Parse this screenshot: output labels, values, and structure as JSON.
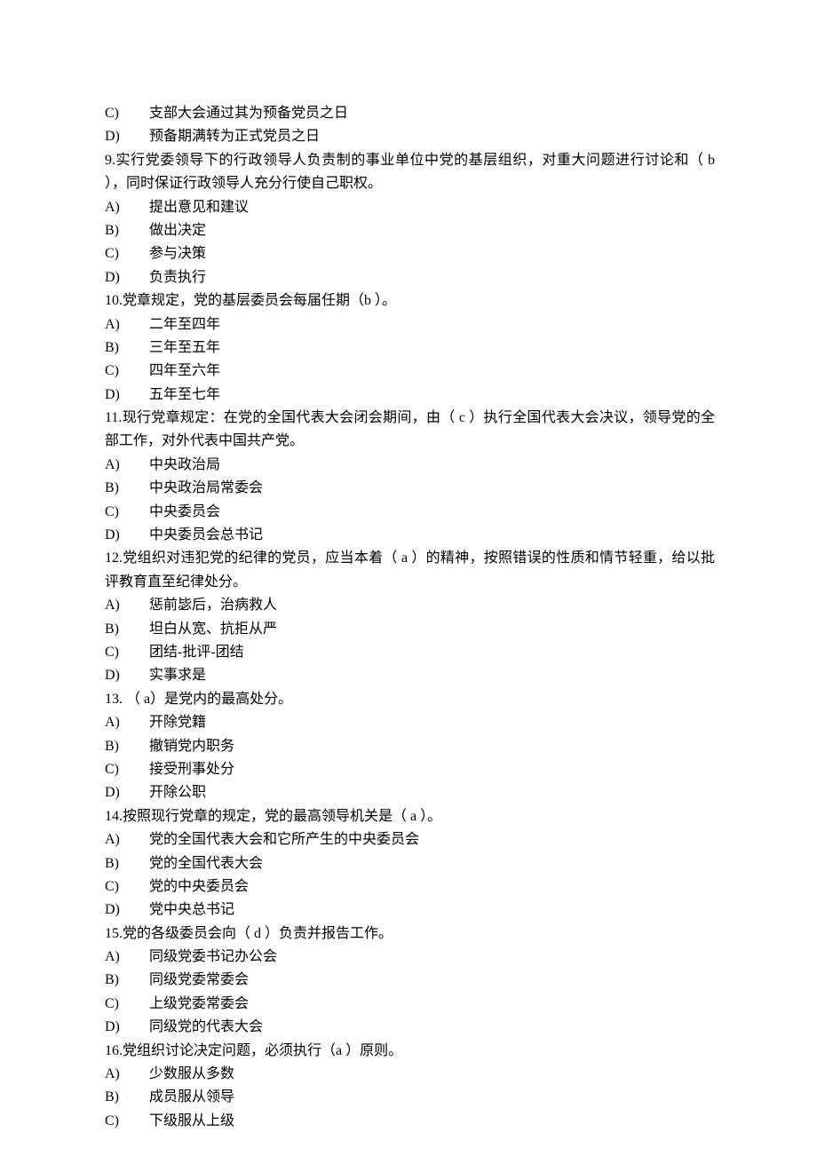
{
  "lines": [
    {
      "type": "opt",
      "letter": "C)",
      "text": "支部大会通过其为预备党员之日"
    },
    {
      "type": "opt",
      "letter": "D)",
      "text": "预备期满转为正式党员之日"
    },
    {
      "type": "q",
      "text": "9.实行党委领导下的行政领导人负责制的事业单位中党的基层组织，对重大问题进行讨论和（ b  ），同时保证行政领导人充分行使自己职权。"
    },
    {
      "type": "opt",
      "letter": "A)",
      "text": "提出意见和建议"
    },
    {
      "type": "opt",
      "letter": "B)",
      "text": "做出决定"
    },
    {
      "type": "opt",
      "letter": "C)",
      "text": "参与决策"
    },
    {
      "type": "opt",
      "letter": "D)",
      "text": "负责执行"
    },
    {
      "type": "q",
      "text": "10.党章规定，党的基层委员会每届任期（b   ）。"
    },
    {
      "type": "opt",
      "letter": "A)",
      "text": "二年至四年"
    },
    {
      "type": "opt",
      "letter": "B)",
      "text": "三年至五年"
    },
    {
      "type": "opt",
      "letter": "C)",
      "text": "四年至六年"
    },
    {
      "type": "opt",
      "letter": "D)",
      "text": "五年至七年"
    },
    {
      "type": "q",
      "text": "11.现行党章规定：在党的全国代表大会闭会期间，由（ c  ）执行全国代表大会决议，领导党的全部工作，对外代表中国共产党。"
    },
    {
      "type": "opt",
      "letter": "A)",
      "text": "中央政治局"
    },
    {
      "type": "opt",
      "letter": "B)",
      "text": "中央政治局常委会"
    },
    {
      "type": "opt",
      "letter": "C)",
      "text": "中央委员会"
    },
    {
      "type": "opt",
      "letter": "D)",
      "text": "中央委员会总书记"
    },
    {
      "type": "q",
      "text": "12.党组织对违犯党的纪律的党员，应当本着（ a  ）的精神，按照错误的性质和情节轻重，给以批评教育直至纪律处分。"
    },
    {
      "type": "opt",
      "letter": "A)",
      "text": "惩前毖后，治病救人"
    },
    {
      "type": "opt",
      "letter": "B)",
      "text": "坦白从宽、抗拒从严"
    },
    {
      "type": "opt",
      "letter": "C)",
      "text": "团结-批评-团结"
    },
    {
      "type": "opt",
      "letter": "D)",
      "text": "实事求是"
    },
    {
      "type": "q",
      "text": "13. （   a）是党内的最高处分。"
    },
    {
      "type": "opt",
      "letter": "A)",
      "text": "开除党籍"
    },
    {
      "type": "opt",
      "letter": "B)",
      "text": "撤销党内职务"
    },
    {
      "type": "opt",
      "letter": "C)",
      "text": "接受刑事处分"
    },
    {
      "type": "opt",
      "letter": "D)",
      "text": "开除公职"
    },
    {
      "type": "q",
      "text": "14.按照现行党章的规定，党的最高领导机关是（ a  ）。"
    },
    {
      "type": "opt",
      "letter": "A)",
      "text": "党的全国代表大会和它所产生的中央委员会"
    },
    {
      "type": "opt",
      "letter": "B)",
      "text": "党的全国代表大会"
    },
    {
      "type": "opt",
      "letter": "C)",
      "text": "党的中央委员会"
    },
    {
      "type": "opt",
      "letter": "D)",
      "text": "党中央总书记"
    },
    {
      "type": "q",
      "text": "15.党的各级委员会向（ d  ）负责并报告工作。"
    },
    {
      "type": "opt",
      "letter": "A)",
      "text": "同级党委书记办公会"
    },
    {
      "type": "opt",
      "letter": "B)",
      "text": "同级党委常委会"
    },
    {
      "type": "opt",
      "letter": "C)",
      "text": "上级党委常委会"
    },
    {
      "type": "opt",
      "letter": "D)",
      "text": "同级党的代表大会"
    },
    {
      "type": "q",
      "text": "16.党组织讨论决定问题，必须执行（a   ）原则。"
    },
    {
      "type": "opt",
      "letter": "A)",
      "text": "少数服从多数"
    },
    {
      "type": "opt",
      "letter": "B)",
      "text": "成员服从领导"
    },
    {
      "type": "opt",
      "letter": "C)",
      "text": "下级服从上级"
    }
  ]
}
